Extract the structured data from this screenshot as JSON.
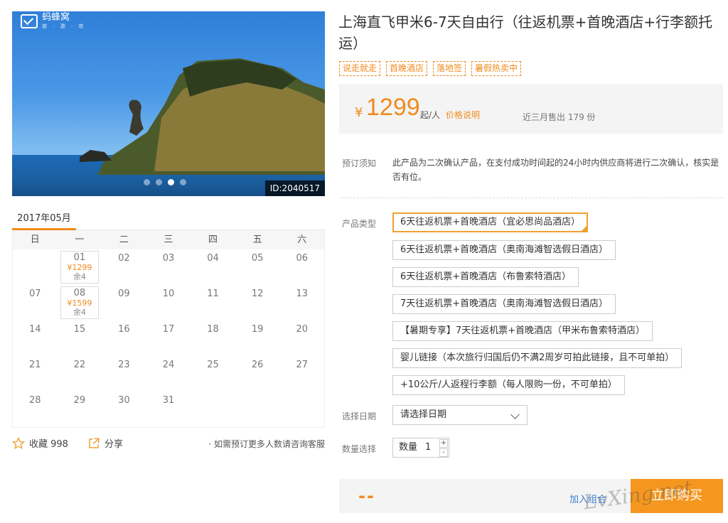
{
  "gallery": {
    "logo_text": "蚂蜂窝",
    "logo_sub": "旅 · 游 · 攻",
    "photo_id": "ID:2040517",
    "dot_count": 4,
    "active_dot": 3
  },
  "calendar": {
    "month": "2017年05月",
    "weekdays": [
      "日",
      "一",
      "二",
      "三",
      "四",
      "五",
      "六"
    ],
    "days": [
      {
        "d": ""
      },
      {
        "d": "01",
        "price": "¥1299",
        "left": "余4"
      },
      {
        "d": "02"
      },
      {
        "d": "03"
      },
      {
        "d": "04"
      },
      {
        "d": "05"
      },
      {
        "d": "06"
      },
      {
        "d": "07"
      },
      {
        "d": "08",
        "price": "¥1599",
        "left": "余4"
      },
      {
        "d": "09"
      },
      {
        "d": "10"
      },
      {
        "d": "11"
      },
      {
        "d": "12"
      },
      {
        "d": "13"
      },
      {
        "d": "14"
      },
      {
        "d": "15"
      },
      {
        "d": "16"
      },
      {
        "d": "17"
      },
      {
        "d": "18"
      },
      {
        "d": "19"
      },
      {
        "d": "20"
      },
      {
        "d": "21"
      },
      {
        "d": "22"
      },
      {
        "d": "23"
      },
      {
        "d": "24"
      },
      {
        "d": "25"
      },
      {
        "d": "26"
      },
      {
        "d": "27"
      },
      {
        "d": "28"
      },
      {
        "d": "29"
      },
      {
        "d": "30"
      },
      {
        "d": "31"
      }
    ]
  },
  "actions": {
    "fav_label": "收藏 998",
    "share_label": "分享",
    "notice": "· 如需预订更多人数请咨询客服"
  },
  "product": {
    "title": "上海直飞甲米6-7天自由行（往返机票+首晚酒店+行李额托运）",
    "tags": [
      "说走就走",
      "首晚酒店",
      "落地签",
      "暑假热卖中"
    ],
    "price_currency": "¥",
    "price": "1299",
    "price_unit": "起/人",
    "price_explain": "价格说明",
    "sold": "近三月售出 179 份",
    "notice_label": "预订须知",
    "notice_text": "此产品为二次确认产品，在支付成功时间起的24小时内供应商将进行二次确认，核实是否有位。",
    "type_label": "产品类型",
    "options": [
      "6天往返机票+首晚酒店（宜必思尚品酒店）",
      "6天往返机票+首晚酒店（奥南海滩智选假日酒店）",
      "6天往返机票+首晚酒店（布鲁索特酒店）",
      "7天往返机票+首晚酒店（奥南海滩智选假日酒店）",
      "【暑期专享】7天往返机票+首晚酒店（甲米布鲁索特酒店）",
      "婴儿链接（本次旅行归国后仍不满2周岁可拍此链接，且不可单拍）",
      "+10公斤/人返程行李额（每人限购一份，不可单拍）"
    ],
    "selected_option": 0,
    "date_label": "选择日期",
    "date_placeholder": "请选择日期",
    "qty_label_left": "数量选择",
    "qty_label": "数量",
    "qty_value": "1",
    "qty_plus": "+",
    "qty_minus": "-"
  },
  "bottom": {
    "total": "--",
    "combo": "加入组合",
    "buy": "立即购买",
    "watermark": "LvXing.net"
  },
  "colors": {
    "accent": "#f08a1d",
    "buy": "#f5971f",
    "link": "#3b7fd0"
  }
}
